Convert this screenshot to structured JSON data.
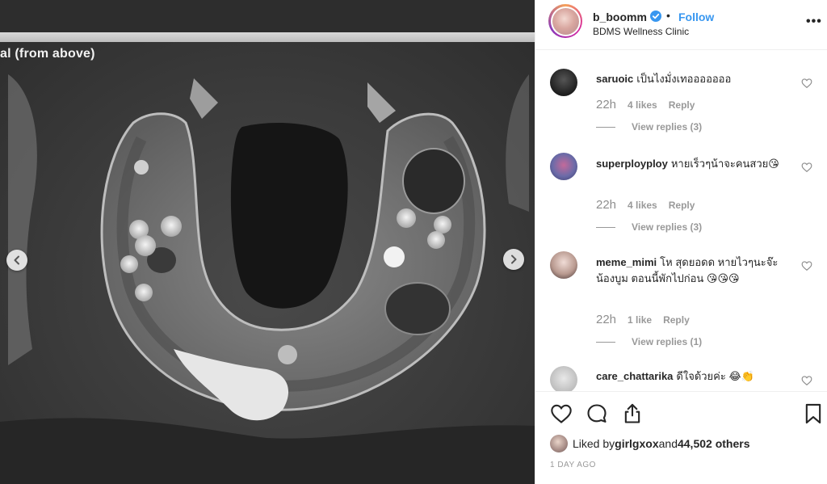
{
  "media": {
    "caption": "al (from above)"
  },
  "post": {
    "username": "b_boomm",
    "follow_label": "Follow",
    "dot": "•",
    "location": "BDMS Wellness Clinic",
    "more_icon": "•••"
  },
  "comments": [
    {
      "user": "saruoic",
      "text": "เป็นไงมั่งเทอออออออ",
      "time": "22h",
      "likes": "4 likes",
      "reply_label": "Reply",
      "view_replies": "View replies (3)"
    },
    {
      "user": "superployploy",
      "text": "หายเร็วๆน้าจะคนสวย😘",
      "time": "22h",
      "likes": "4 likes",
      "reply_label": "Reply",
      "view_replies": "View replies (3)"
    },
    {
      "user": "meme_mimi",
      "text": "โห สุดยอดด หายไวๆนะจ๊ะน้องบูม ตอนนี้พักไปก่อน 😘😘😘",
      "time": "22h",
      "likes": "1 like",
      "reply_label": "Reply",
      "view_replies": "View replies (1)"
    },
    {
      "user": "care_chattarika",
      "text": "ดีใจด้วยค่ะ 😂👏"
    }
  ],
  "likes": {
    "prefix": "Liked by ",
    "user": "girlgxox",
    "middle": " and ",
    "count": "44,502 others"
  },
  "date": "1 DAY AGO",
  "colors": {
    "link": "#3897f0",
    "text": "#262626",
    "muted": "#999999"
  }
}
